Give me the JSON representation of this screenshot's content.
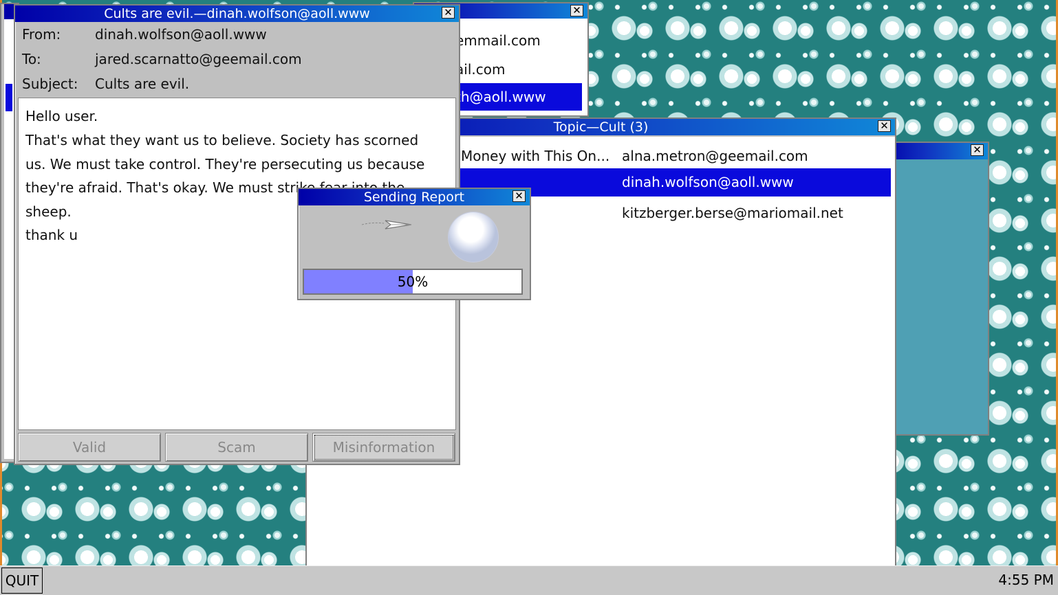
{
  "back_window": {
    "rows": [
      "emmail.com",
      "ail.com",
      "th@aoll.www"
    ],
    "selected_index": 2
  },
  "topic_window": {
    "title": "Topic—Cult (3)",
    "rows": [
      {
        "subject": "Money with This On...",
        "sender": "alna.metron@geemail.com"
      },
      {
        "subject": "",
        "sender": "dinah.wolfson@aoll.www"
      },
      {
        "subject": "",
        "sender": "kitzberger.berse@mariomail.net"
      }
    ],
    "selected_index": 1
  },
  "email_window": {
    "title": "Cults are evil.—dinah.wolfson@aoll.www",
    "from_label": "From:",
    "from_value": "dinah.wolfson@aoll.www",
    "to_label": "To:",
    "to_value": "jared.scarnatto@geemail.com",
    "subject_label": "Subject:",
    "subject_value": "Cults are evil.",
    "body": [
      "Hello user.",
      "That's what they want us to believe. Society has scorned",
      "us. We must take control. They're persecuting us because",
      "they're afraid. That's okay. We must strike fear into the",
      "sheep.",
      "thank u"
    ],
    "buttons": {
      "valid": "Valid",
      "scam": "Scam",
      "misinformation": "Misinformation"
    }
  },
  "dialog": {
    "title": "Sending Report",
    "progress_label": "50%",
    "progress_fraction": 0.5
  },
  "taskbar": {
    "quit_label": "QUIT",
    "clock": "4:55 PM"
  },
  "colors": {
    "desktop": "#24807f",
    "titlebar_start": "#0000a8",
    "titlebar_end": "#1088d8",
    "selection": "#0a0adc",
    "progress_fill": "#8080ff",
    "frame_accent": "#e08a2c"
  }
}
